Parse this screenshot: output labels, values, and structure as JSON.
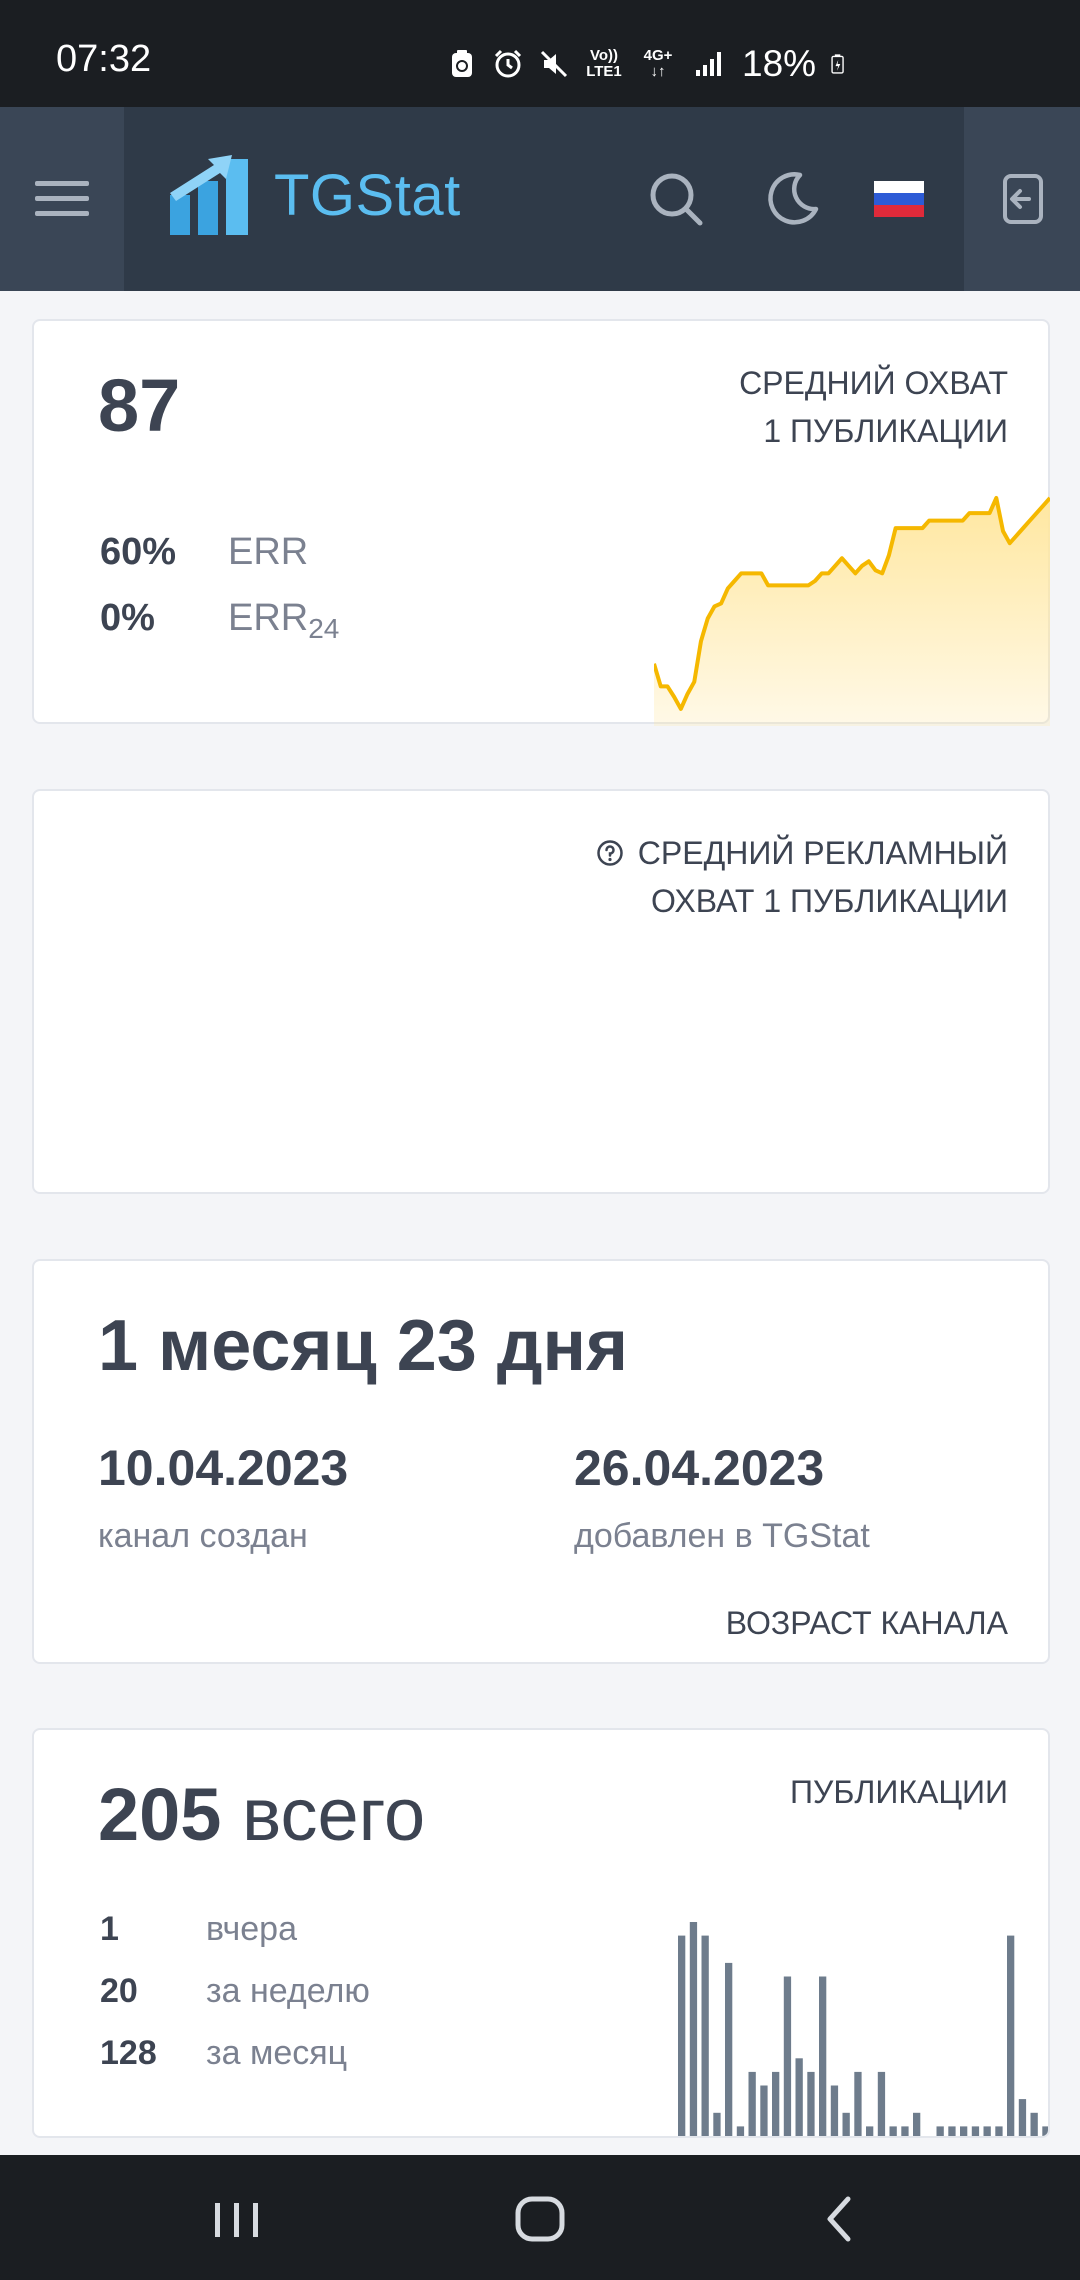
{
  "status_bar": {
    "time": "07:32",
    "network_line1": "Vo))",
    "network_line2": "LTE1",
    "network_type": "4G+",
    "battery": "18%",
    "icons": [
      "recycle-icon",
      "alarm-icon",
      "mute-icon",
      "signal-icon",
      "battery-icon"
    ]
  },
  "header": {
    "logo_text": "TGStat",
    "icons": [
      "menu-icon",
      "search-icon",
      "moon-icon",
      "russia-flag-icon",
      "sign-in-icon"
    ],
    "colors": {
      "bar": "#2f3a48",
      "logo": "#5bbdf0"
    }
  },
  "reach_card": {
    "value": "87",
    "caption_line1": "СРЕДНИЙ ОХВАТ",
    "caption_line2": "1 ПУБЛИКАЦИИ",
    "err_value": "60%",
    "err_label": "ERR",
    "err24_value": "0%",
    "err24_label": "ERR",
    "err24_sub": "24"
  },
  "ad_reach_card": {
    "caption_line1": "СРЕДНИЙ РЕКЛАМНЫЙ",
    "caption_line2": "ОХВАТ 1 ПУБЛИКАЦИИ",
    "help_icon": "help-circle-icon"
  },
  "age_card": {
    "age": "1 месяц 23 дня",
    "created_date": "10.04.2023",
    "created_label": "канал создан",
    "added_date": "26.04.2023",
    "added_label": "добавлен в TGStat",
    "caption": "ВОЗРАСТ КАНАЛА"
  },
  "posts_card": {
    "total_number": "205",
    "total_word": "всего",
    "caption": "ПУБЛИКАЦИИ",
    "rows": [
      {
        "value": "1",
        "label": "вчера"
      },
      {
        "value": "20",
        "label": "за неделю"
      },
      {
        "value": "128",
        "label": "за месяц"
      }
    ]
  },
  "nav_bar": {
    "icons": [
      "recent-apps-icon",
      "home-icon",
      "back-icon"
    ]
  },
  "chart_data": [
    {
      "type": "area",
      "series": [
        {
          "values": [
            40,
            25,
            25,
            18,
            10,
            20,
            28,
            55,
            70,
            78,
            80,
            90,
            95,
            100,
            100,
            100,
            100,
            92,
            92,
            92,
            92,
            92,
            92,
            92,
            95,
            100,
            100,
            105,
            110,
            105,
            100,
            105,
            108,
            102,
            100,
            112,
            130,
            130,
            130,
            130,
            130,
            135,
            135,
            135,
            135,
            135,
            135,
            140,
            140,
            140,
            140,
            150,
            128,
            120,
            125,
            130,
            135,
            140,
            145,
            150
          ]
        }
      ],
      "colors": {
        "line": "#f5b800",
        "fill": "#ffe7a0"
      }
    },
    {
      "type": "bar",
      "values": [
        15,
        16,
        15,
        2,
        13,
        1,
        5,
        4,
        5,
        12,
        6,
        5,
        12,
        4,
        2,
        5,
        1,
        5,
        1,
        1,
        2,
        0,
        1,
        1,
        1,
        1,
        1,
        1,
        15,
        3,
        2,
        1
      ],
      "colors": {
        "bar": "#6e7c8c"
      }
    }
  ]
}
